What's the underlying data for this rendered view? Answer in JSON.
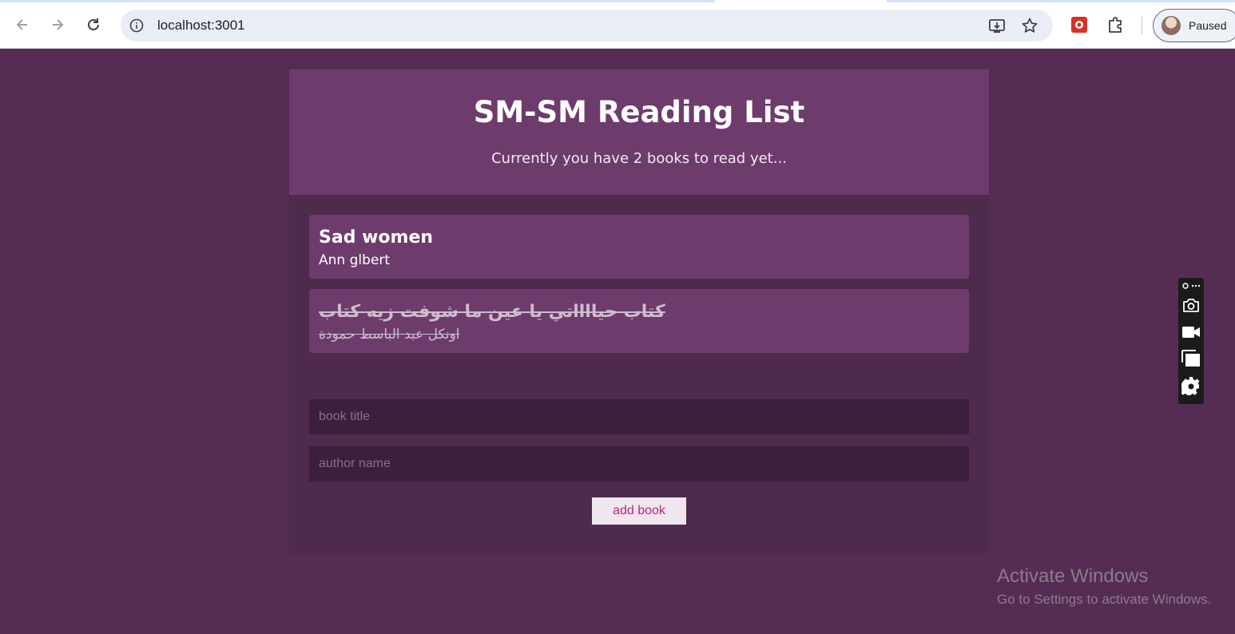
{
  "browser": {
    "url": "localhost:3001",
    "profile_label": "Paused"
  },
  "app": {
    "title": "SM-SM Reading List",
    "subtitle": "Currently you have 2 books to read yet...",
    "books": [
      {
        "title": "Sad women",
        "author": "Ann glbert",
        "completed": false
      },
      {
        "title": "كتاب حيااااتي يا عين ما شوفت زيه كتاب",
        "author": "اونكل عبد الباسط حمودة",
        "completed": true
      }
    ],
    "form": {
      "title_placeholder": "book title",
      "author_placeholder": "author name",
      "submit_label": "add book"
    }
  },
  "watermark": {
    "line1": "Activate Windows",
    "line2": "Go to Settings to activate Windows."
  },
  "colors": {
    "page_bg": "#552d52",
    "panel_bg": "#4e2a4d",
    "header_bg": "#6e3b6d",
    "input_bg": "#3c1f3b",
    "button_text": "#b8287a"
  }
}
